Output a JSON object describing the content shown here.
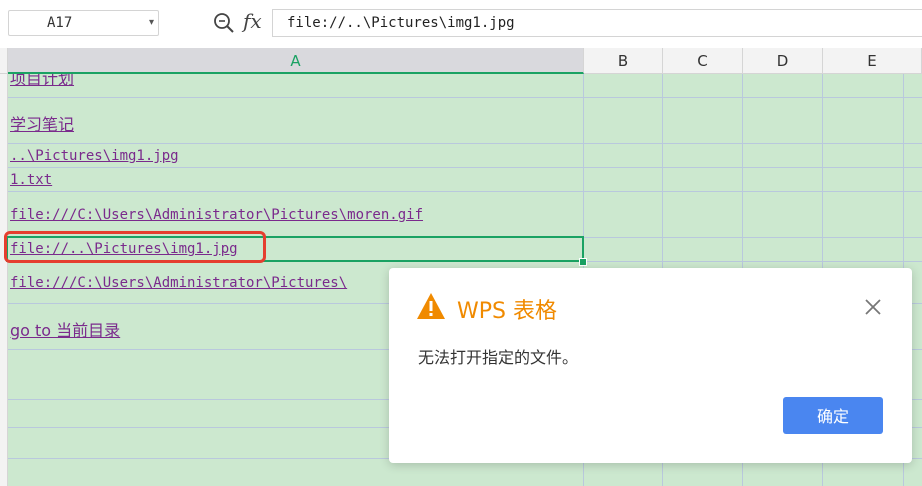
{
  "formula_bar": {
    "cell_reference": "A17",
    "dropdown_arrow": "▾",
    "fx_label": "fx",
    "formula": "file://..\\Pictures\\img1.jpg"
  },
  "columns": [
    "A",
    "B",
    "C",
    "D",
    "E"
  ],
  "active_column": "A",
  "cells": [
    "项目计划",
    "学习笔记",
    "..\\Pictures\\img1.jpg",
    "1.txt",
    "file:///C:\\Users\\Administrator\\Pictures\\moren.gif",
    "file://..\\Pictures\\img1.jpg",
    "file:///C:\\Users\\Administrator\\Pictures\\",
    "go to 当前目录"
  ],
  "dialog": {
    "title": "WPS 表格",
    "message": "无法打开指定的文件。",
    "ok_label": "确定"
  },
  "colors": {
    "grid_background": "#cce8cf",
    "active_accent": "#1aa263",
    "link_color": "#7a2a8c",
    "highlight_red": "#e53e2f",
    "dialog_title": "#f08a00",
    "ok_button": "#4a86f0"
  }
}
